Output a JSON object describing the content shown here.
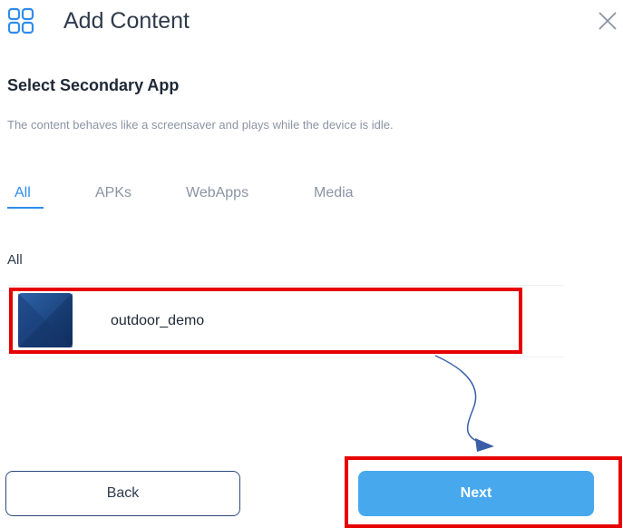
{
  "header": {
    "title": "Add Content",
    "icon": "grid-icon",
    "close_icon": "close-icon"
  },
  "section": {
    "title": "Select Secondary App",
    "description": "The content behaves like a screensaver and plays while the device is idle."
  },
  "tabs": [
    {
      "label": "All",
      "active": true
    },
    {
      "label": "APKs",
      "active": false
    },
    {
      "label": "WebApps",
      "active": false
    },
    {
      "label": "Media",
      "active": false
    }
  ],
  "group_label": "All",
  "apps": [
    {
      "name": "outdoor_demo",
      "icon": "app-thumbnail"
    }
  ],
  "footer": {
    "back_label": "Back",
    "next_label": "Next"
  },
  "colors": {
    "accent": "#2f8ceb",
    "next_button": "#47a8ee",
    "highlight": "#e60000",
    "arrow": "#3a5fa8"
  }
}
